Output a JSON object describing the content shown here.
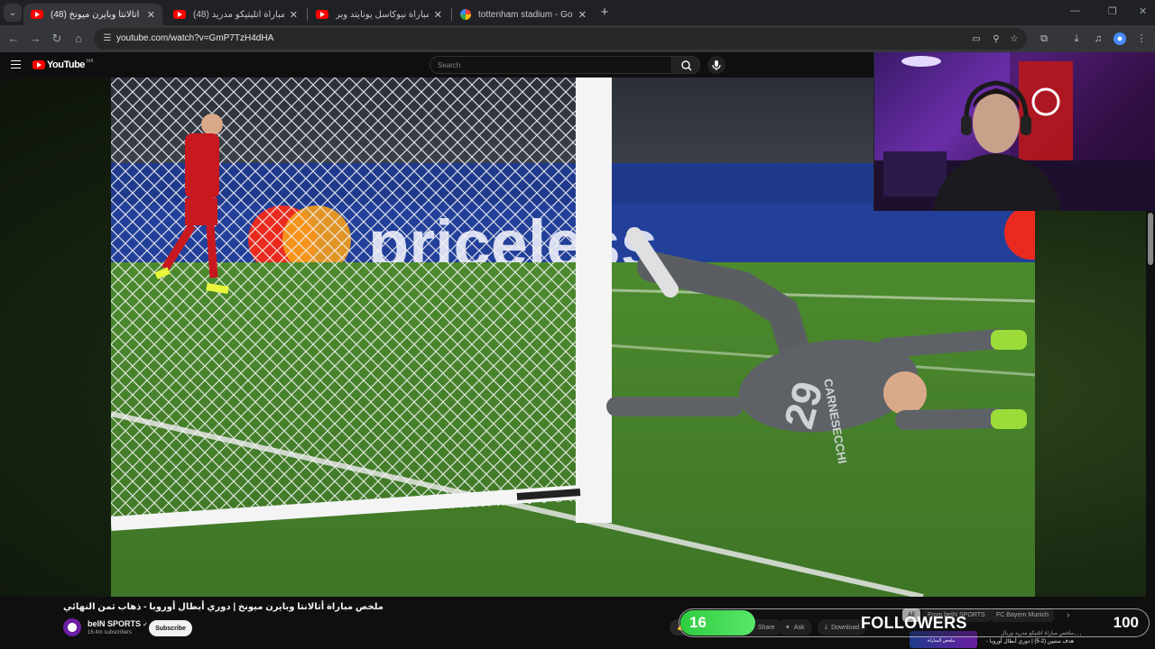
{
  "browser": {
    "tabs": [
      {
        "title": "(48) ملخص مباراة أتالانتا وبايرن ميونخ",
        "favicon": "youtube-icon",
        "active": true
      },
      {
        "title": "(48) ملخص مباراة أتليتيكو مدريد",
        "favicon": "youtube-icon",
        "active": false
      },
      {
        "title": "ملخص مباراة نيوكاسل يونايتد وبر",
        "favicon": "youtube-icon",
        "active": false
      },
      {
        "title": "tottenham stadium - Google Se",
        "favicon": "google-icon",
        "active": false
      }
    ],
    "url": "youtube.com/watch?v=GmP7TzH4dHA"
  },
  "youtube": {
    "logo_text": "YouTube",
    "region": "MA",
    "search_placeholder": "Search"
  },
  "video": {
    "ad_text": "priceless",
    "jersey_name": "CARNESECCHI",
    "jersey_number": "29"
  },
  "watch": {
    "title": "ملخص مباراة أتالانتا وبايرن ميونخ | دوري أبطال أوروبا - ذهاب ثمن النهائي",
    "channel_name": "beIN SPORTS",
    "subscribers": "16.4m subscribers",
    "subscribe_label": "Subscribe",
    "share_label": "Share",
    "ask_label": "Ask",
    "download_label": "Download"
  },
  "chips": [
    "All",
    "From beIN SPORTS",
    "FC Bayern Munich"
  ],
  "related": {
    "title_line1": "ملخص مباراة أتلتيكو مدريد وريال",
    "title_line2": "هدف ستيين (2-5) | دوري أبطال أوروبا -",
    "thumb_text": "ملخص المباراة"
  },
  "followers": {
    "current": "16",
    "label": "FOLLOWERS",
    "goal": "100",
    "progress": 0.16
  },
  "colors": {
    "youtube_red": "#ff0000",
    "progress_green": "#2ecc40",
    "pitch_green": "#4f7f2a"
  }
}
